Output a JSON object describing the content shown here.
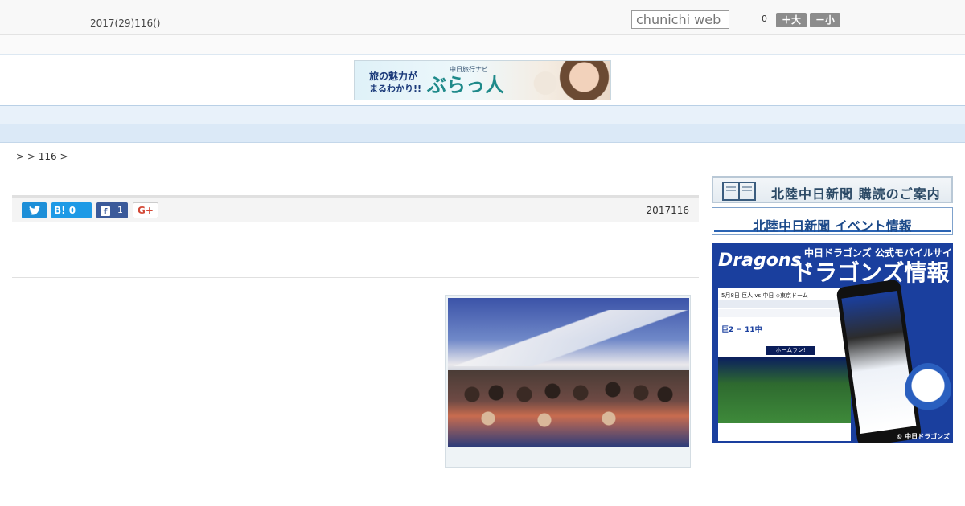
{
  "header": {
    "date": "2017(29)116()",
    "search_placeholder": "chunichi web",
    "zoom_value": "0",
    "enlarge_label": "＋大",
    "shrink_label": "－小"
  },
  "banner": {
    "line1": "旅の魅力が",
    "line2": "まるわかり!!",
    "sub": "中日旅行ナビ",
    "logo": "ぶらっ人"
  },
  "nav": {
    "items": [
      "    ",
      "    ",
      "    ",
      "    ",
      "    ",
      "    ",
      "    ",
      "    ",
      "    "
    ]
  },
  "breadcrumb": ">  > 116 >",
  "share": {
    "hatena_label": "B! 0",
    "facebook_count": "1",
    "gplus_label": "G+",
    "article_date": "2017116"
  },
  "sidebar": {
    "subscribe_label": "北陸中日新聞 購読のご案内",
    "event_label": "北陸中日新聞 イベント情報",
    "dragons": {
      "logo": "Dragons",
      "top_line": "中日ドラゴンズ 公式モバイルサイト",
      "big_text": "ドラゴンズ情報",
      "caption": "5月8日 巨人 vs 中日 ◇東京ドーム",
      "score": "巨2 − 11中",
      "home_run": "ホームラン!",
      "copyright": "© 中日ドラゴンズ"
    }
  }
}
